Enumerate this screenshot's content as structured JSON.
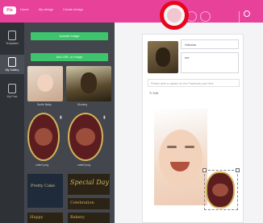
{
  "topbar": {
    "logo": "Pix",
    "menu": [
      "Home",
      "My design",
      "Create design"
    ],
    "highlight_color": "#e8061c",
    "brand_color": "#e8419a"
  },
  "rail": {
    "items": [
      {
        "label": "Templates",
        "icon": "file-icon"
      },
      {
        "label": "My Gallery",
        "icon": "image-icon"
      },
      {
        "label": "My Post",
        "icon": "post-icon"
      }
    ]
  },
  "panel": {
    "upload_button": "Upload Image",
    "fb_button": "Add URL or Image",
    "thumbs": [
      "Smile Baby",
      "Monkey"
    ],
    "files": [
      "cake1.png",
      "cake2.png"
    ],
    "card_texts": [
      "Pretty Cake",
      "Special Day",
      "Celebration",
      "Happy",
      "Bakery"
    ]
  },
  "post": {
    "name_field": "Hahaha",
    "handle_field": "me",
    "caption_placeholder": "Please write a caption for this Facebook post here",
    "edit_label": "Edit"
  }
}
